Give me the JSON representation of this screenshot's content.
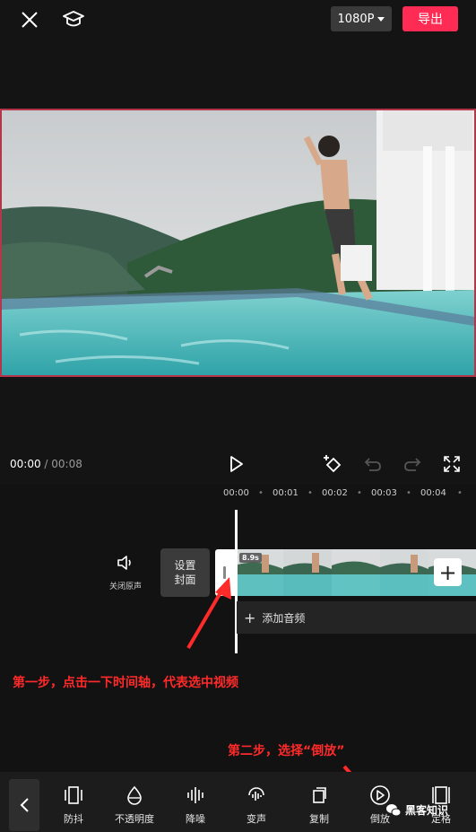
{
  "topbar": {
    "resolution": "1080P",
    "export_label": "导出"
  },
  "player": {
    "current_time": "00:00",
    "separator": " / ",
    "total_time": "00:08"
  },
  "timeline": {
    "ruler": [
      "00:00",
      "00:01",
      "00:02",
      "00:03",
      "00:04"
    ],
    "mute_label": "关闭原声",
    "cover_line1": "设置",
    "cover_line2": "封面",
    "clip_duration": "8.9s",
    "add_audio_label": "添加音频"
  },
  "annotations": {
    "step1": "第一步，点击一下时间轴，代表选中视频",
    "step2": "第二步，选择“倒放”"
  },
  "toolbar": {
    "items": [
      {
        "label": "防抖",
        "icon": "stabilize-icon"
      },
      {
        "label": "不透明度",
        "icon": "opacity-icon"
      },
      {
        "label": "降噪",
        "icon": "denoise-icon"
      },
      {
        "label": "变声",
        "icon": "voice-change-icon"
      },
      {
        "label": "复制",
        "icon": "copy-icon"
      },
      {
        "label": "倒放",
        "icon": "reverse-icon"
      },
      {
        "label": "定格",
        "icon": "freeze-icon"
      }
    ]
  },
  "watermark": "黑客知识",
  "colors": {
    "accent": "#fe2c55",
    "annotation": "#ff2a2a",
    "background": "#141414"
  }
}
